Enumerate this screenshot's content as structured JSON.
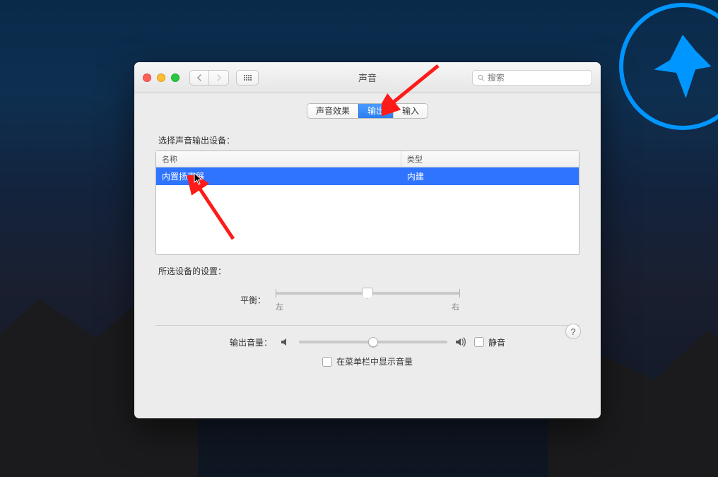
{
  "window": {
    "title": "声音",
    "search_placeholder": "搜索"
  },
  "tabs": {
    "sound_effects": "声音效果",
    "output": "输出",
    "input": "输入"
  },
  "labels": {
    "select_output_device": "选择声音输出设备：",
    "column_name": "名称",
    "column_type": "类型",
    "selected_device_settings": "所选设备的设置：",
    "balance": "平衡：",
    "balance_left": "左",
    "balance_right": "右",
    "output_volume": "输出音量：",
    "mute": "静音",
    "show_in_menubar": "在菜单栏中显示音量"
  },
  "devices": [
    {
      "name": "内置扬声器",
      "type": "内建"
    }
  ],
  "balance_value_percent": 50,
  "volume_value_percent": 50,
  "mute_checked": false,
  "show_in_menubar_checked": false,
  "colors": {
    "selection": "#2f74ff",
    "annotation": "#ff1a1a"
  }
}
